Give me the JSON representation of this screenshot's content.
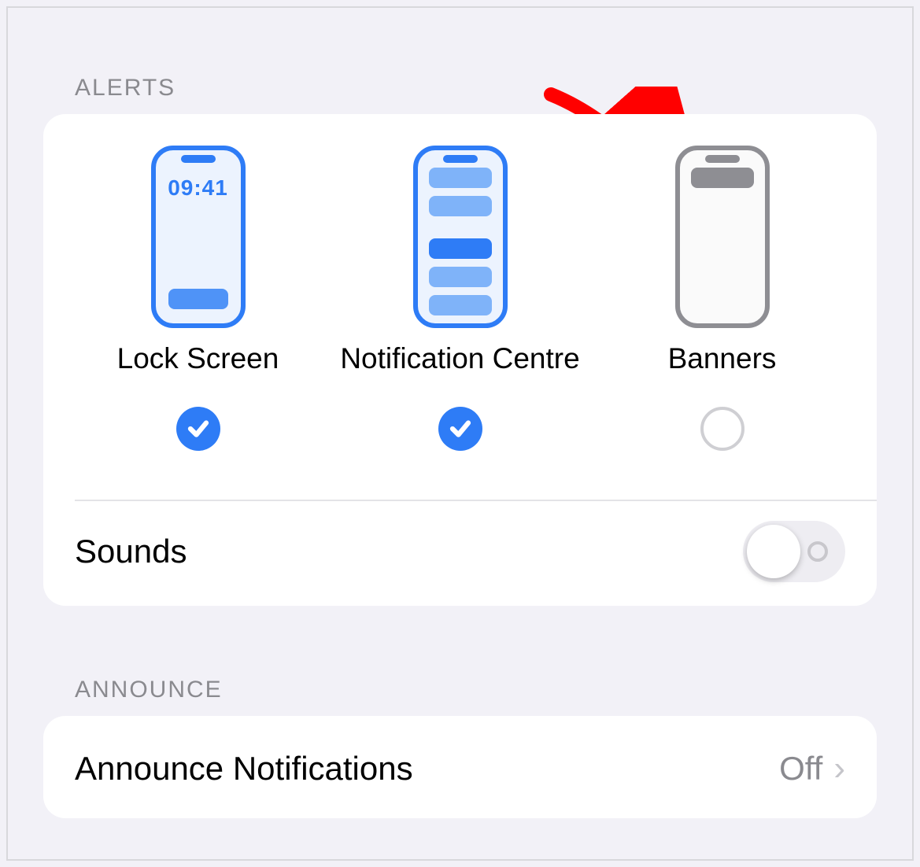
{
  "sections": {
    "alerts_header": "Alerts",
    "announce_header": "Announce"
  },
  "alert_styles": {
    "lock_screen": {
      "label": "Lock Screen",
      "checked": true,
      "time_text": "09:41"
    },
    "notification_centre": {
      "label": "Notification Centre",
      "checked": true
    },
    "banners": {
      "label": "Banners",
      "checked": false
    }
  },
  "sounds": {
    "label": "Sounds",
    "enabled": false
  },
  "announce_notifications": {
    "label": "Announce Notifications",
    "value": "Off"
  },
  "annotation": {
    "arrow_points_to": "banners-option"
  }
}
